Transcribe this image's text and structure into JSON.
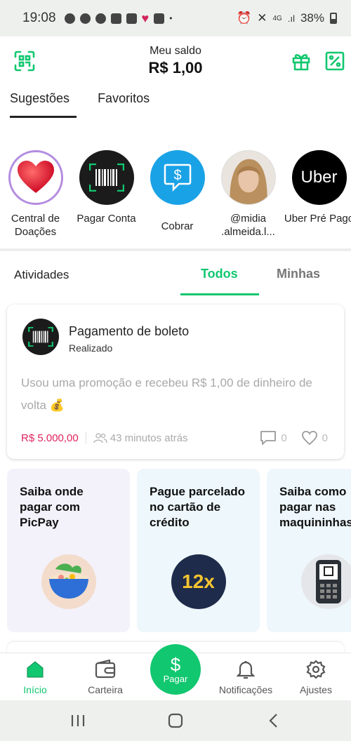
{
  "status_bar": {
    "time": "19:08",
    "signal": "4G",
    "battery": "38%"
  },
  "header": {
    "balance_label": "Meu saldo",
    "balance_value": "R$ 1,00"
  },
  "tabs": [
    {
      "label": "Sugestões",
      "active": true
    },
    {
      "label": "Favoritos",
      "active": false
    }
  ],
  "suggestions": [
    {
      "name": "Central de Doações",
      "icon": "heart-icon"
    },
    {
      "name": "Pagar Conta",
      "icon": "barcode-icon"
    },
    {
      "name": "Cobrar",
      "icon": "money-request-icon"
    },
    {
      "name": "@midia .almeida.l...",
      "icon": "profile-photo"
    },
    {
      "name": "Uber Pré Pago",
      "logo_text": "Uber"
    }
  ],
  "activities": {
    "title": "Atividades",
    "tab_all": "Todos",
    "tab_mine": "Minhas"
  },
  "activity_card": {
    "title": "Pagamento de boleto",
    "status": "Realizado",
    "description": "Usou uma promoção e recebeu R$ 1,00 de dinheiro de volta 💰",
    "amount": "R$ 5.000,00",
    "time_ago": "43 minutos atrás",
    "comments": "0",
    "likes": "0"
  },
  "promos": [
    {
      "text": "Saiba onde pagar com PicPay",
      "bg": "#f3f2fb"
    },
    {
      "text": "Pague parcelado no cartão de crédito",
      "bg": "#eef7fb",
      "badge": "12x"
    },
    {
      "text": "Saiba como pagar nas maquininhas",
      "bg": "#eef7fb"
    }
  ],
  "bottom_nav": {
    "inicio": "Início",
    "carteira": "Carteira",
    "pagar": "Pagar",
    "notificacoes": "Notificações",
    "ajustes": "Ajustes"
  },
  "colors": {
    "brand": "#11c76f",
    "amount": "#e0245e"
  }
}
